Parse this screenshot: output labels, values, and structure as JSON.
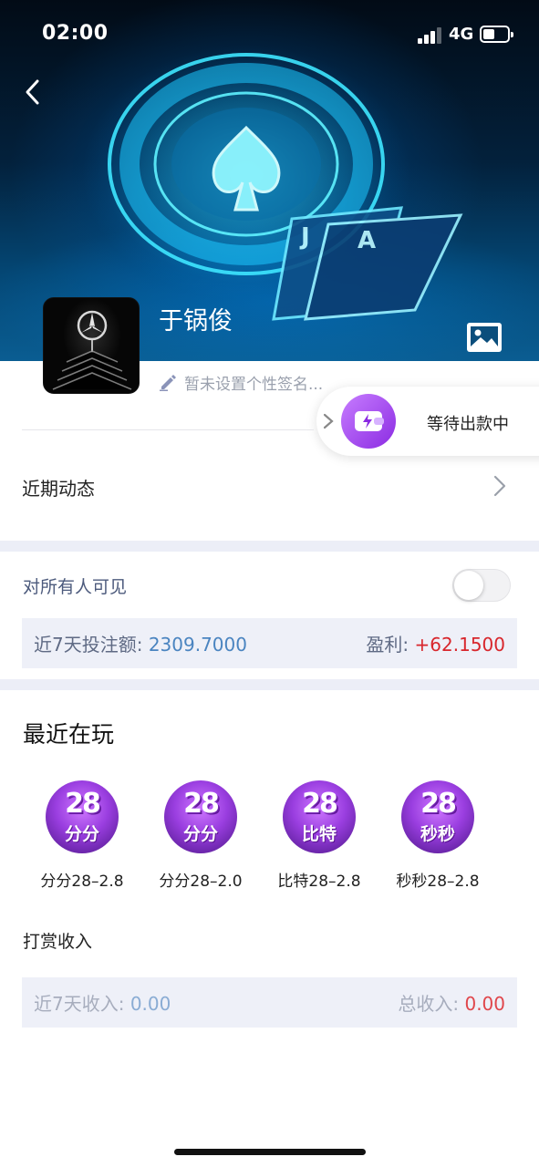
{
  "status_bar": {
    "time": "02:00",
    "network": "4G"
  },
  "profile": {
    "name": "于锅俊",
    "signature_placeholder": "暂未设置个性签名..."
  },
  "withdraw": {
    "label": "等待出款中"
  },
  "recent_activity": {
    "label": "近期动态"
  },
  "visibility": {
    "label": "对所有人可见",
    "enabled": false
  },
  "stats": {
    "bet_label": "近7天投注额:",
    "bet_value": "2309.7000",
    "profit_label": "盈利:",
    "profit_value": "+62.1500"
  },
  "recently_played": {
    "title": "最近在玩",
    "games": [
      {
        "badge_num": "28",
        "badge_text": "分分",
        "name": "分分28–2.8"
      },
      {
        "badge_num": "28",
        "badge_text": "分分",
        "name": "分分28–2.0"
      },
      {
        "badge_num": "28",
        "badge_text": "比特",
        "name": "比特28–2.8"
      },
      {
        "badge_num": "28",
        "badge_text": "秒秒",
        "name": "秒秒28–2.8"
      }
    ]
  },
  "tip_income": {
    "title": "打赏收入",
    "week_label": "近7天收入:",
    "week_value": "0.00",
    "total_label": "总收入:",
    "total_value": "0.00"
  },
  "colors": {
    "accent_blue": "#4a84c0",
    "profit_red": "#d8262c",
    "wallet_purple": "#8b2be2"
  }
}
